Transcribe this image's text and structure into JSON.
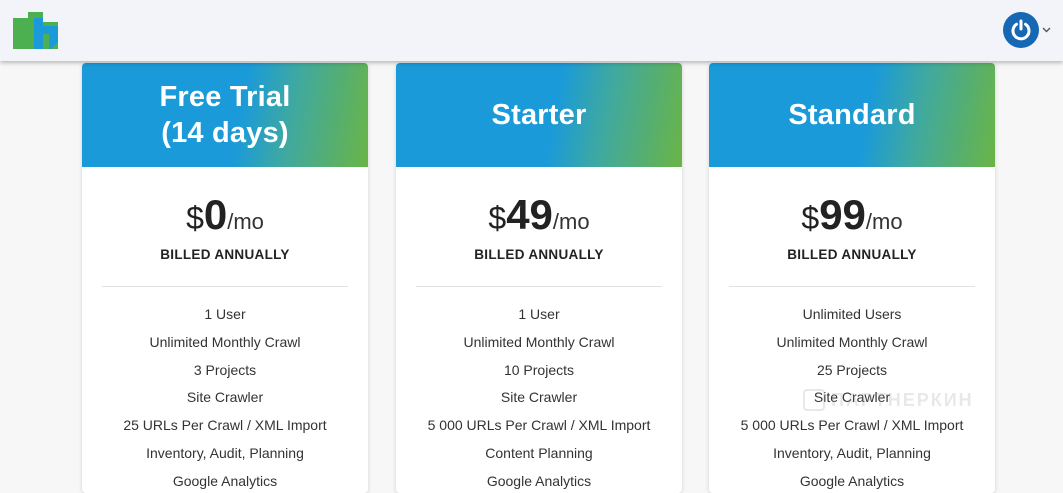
{
  "header": {
    "logo_icon": "brand-logo-icon",
    "user_icon": "power-icon",
    "brand_colors": [
      "#4caf50",
      "#1a9ad9"
    ]
  },
  "plans": [
    {
      "name": "Free Trial\n(14 days)",
      "currency": "$",
      "amount": "0",
      "period": "/mo",
      "billing": "BILLED ANNUALLY",
      "features": [
        "1 User",
        "Unlimited Monthly Crawl",
        "3 Projects",
        "Site Crawler",
        "25 URLs Per Crawl / XML Import",
        "Inventory, Audit, Planning",
        "Google Analytics"
      ]
    },
    {
      "name": "Starter",
      "currency": "$",
      "amount": "49",
      "period": "/mo",
      "billing": "BILLED ANNUALLY",
      "features": [
        "1 User",
        "Unlimited Monthly Crawl",
        "10 Projects",
        "Site Crawler",
        "5 000 URLs Per Crawl / XML Import",
        "Content Planning",
        "Google Analytics"
      ]
    },
    {
      "name": "Standard",
      "currency": "$",
      "amount": "99",
      "period": "/mo",
      "billing": "BILLED ANNUALLY",
      "features": [
        "Unlimited Users",
        "Unlimited Monthly Crawl",
        "25 Projects",
        "Site Crawler",
        "5 000 URLs Per Crawl / XML Import",
        "Inventory, Audit, Planning",
        "Google Analytics"
      ]
    }
  ],
  "watermark": {
    "text": "ПАРТНЕРКИН"
  }
}
